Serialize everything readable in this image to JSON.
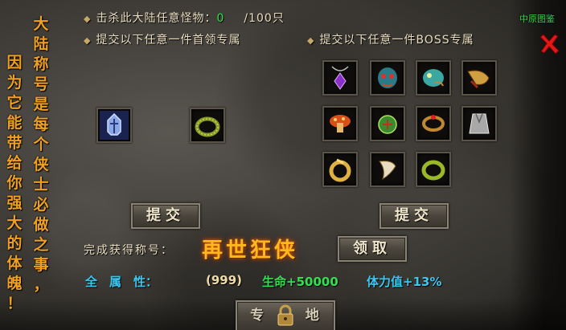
{
  "header": {
    "map_label": "中原图鉴"
  },
  "side_text": {
    "column_1": "因为它能带给你强大的体魄！",
    "column_2": "大陆称号是每个侠士必做之事，"
  },
  "tasks": {
    "kill_label": "击杀此大陆任意怪物：",
    "kill_count": "0",
    "kill_total": "/100只",
    "submit_leader_label": "提交以下任意一件首领专属",
    "submit_boss_label": "提交以下任意一件BOSS专属"
  },
  "items": {
    "leader": [
      "helmet-icon",
      "bracelet-icon"
    ],
    "boss": [
      "amulet-icon",
      "mask-icon",
      "dragon-head-icon",
      "horn-icon",
      "mushroom-icon",
      "jade-pendant-icon",
      "ring-icon",
      "robe-icon",
      "gold-ring-icon",
      "fang-icon",
      "jade-bracelet-icon"
    ]
  },
  "buttons": {
    "submit_leader": "提交",
    "submit_boss": "提交",
    "claim": "领取",
    "exclusive_left": "专",
    "exclusive_right": "地"
  },
  "reward": {
    "title_label": "完成获得称号：",
    "title_name": "再世狂侠",
    "stats_label": "全　属　性：",
    "stats_all": "(999)",
    "stats_hp": "生命+50000",
    "stats_stamina": "体力值+13%"
  },
  "colors": {
    "accent_orange": "#f0a020",
    "count_green": "#2ee04a",
    "hp_green": "#32e050",
    "stat_blue": "#3ac8f0",
    "close_red": "#e01818"
  }
}
